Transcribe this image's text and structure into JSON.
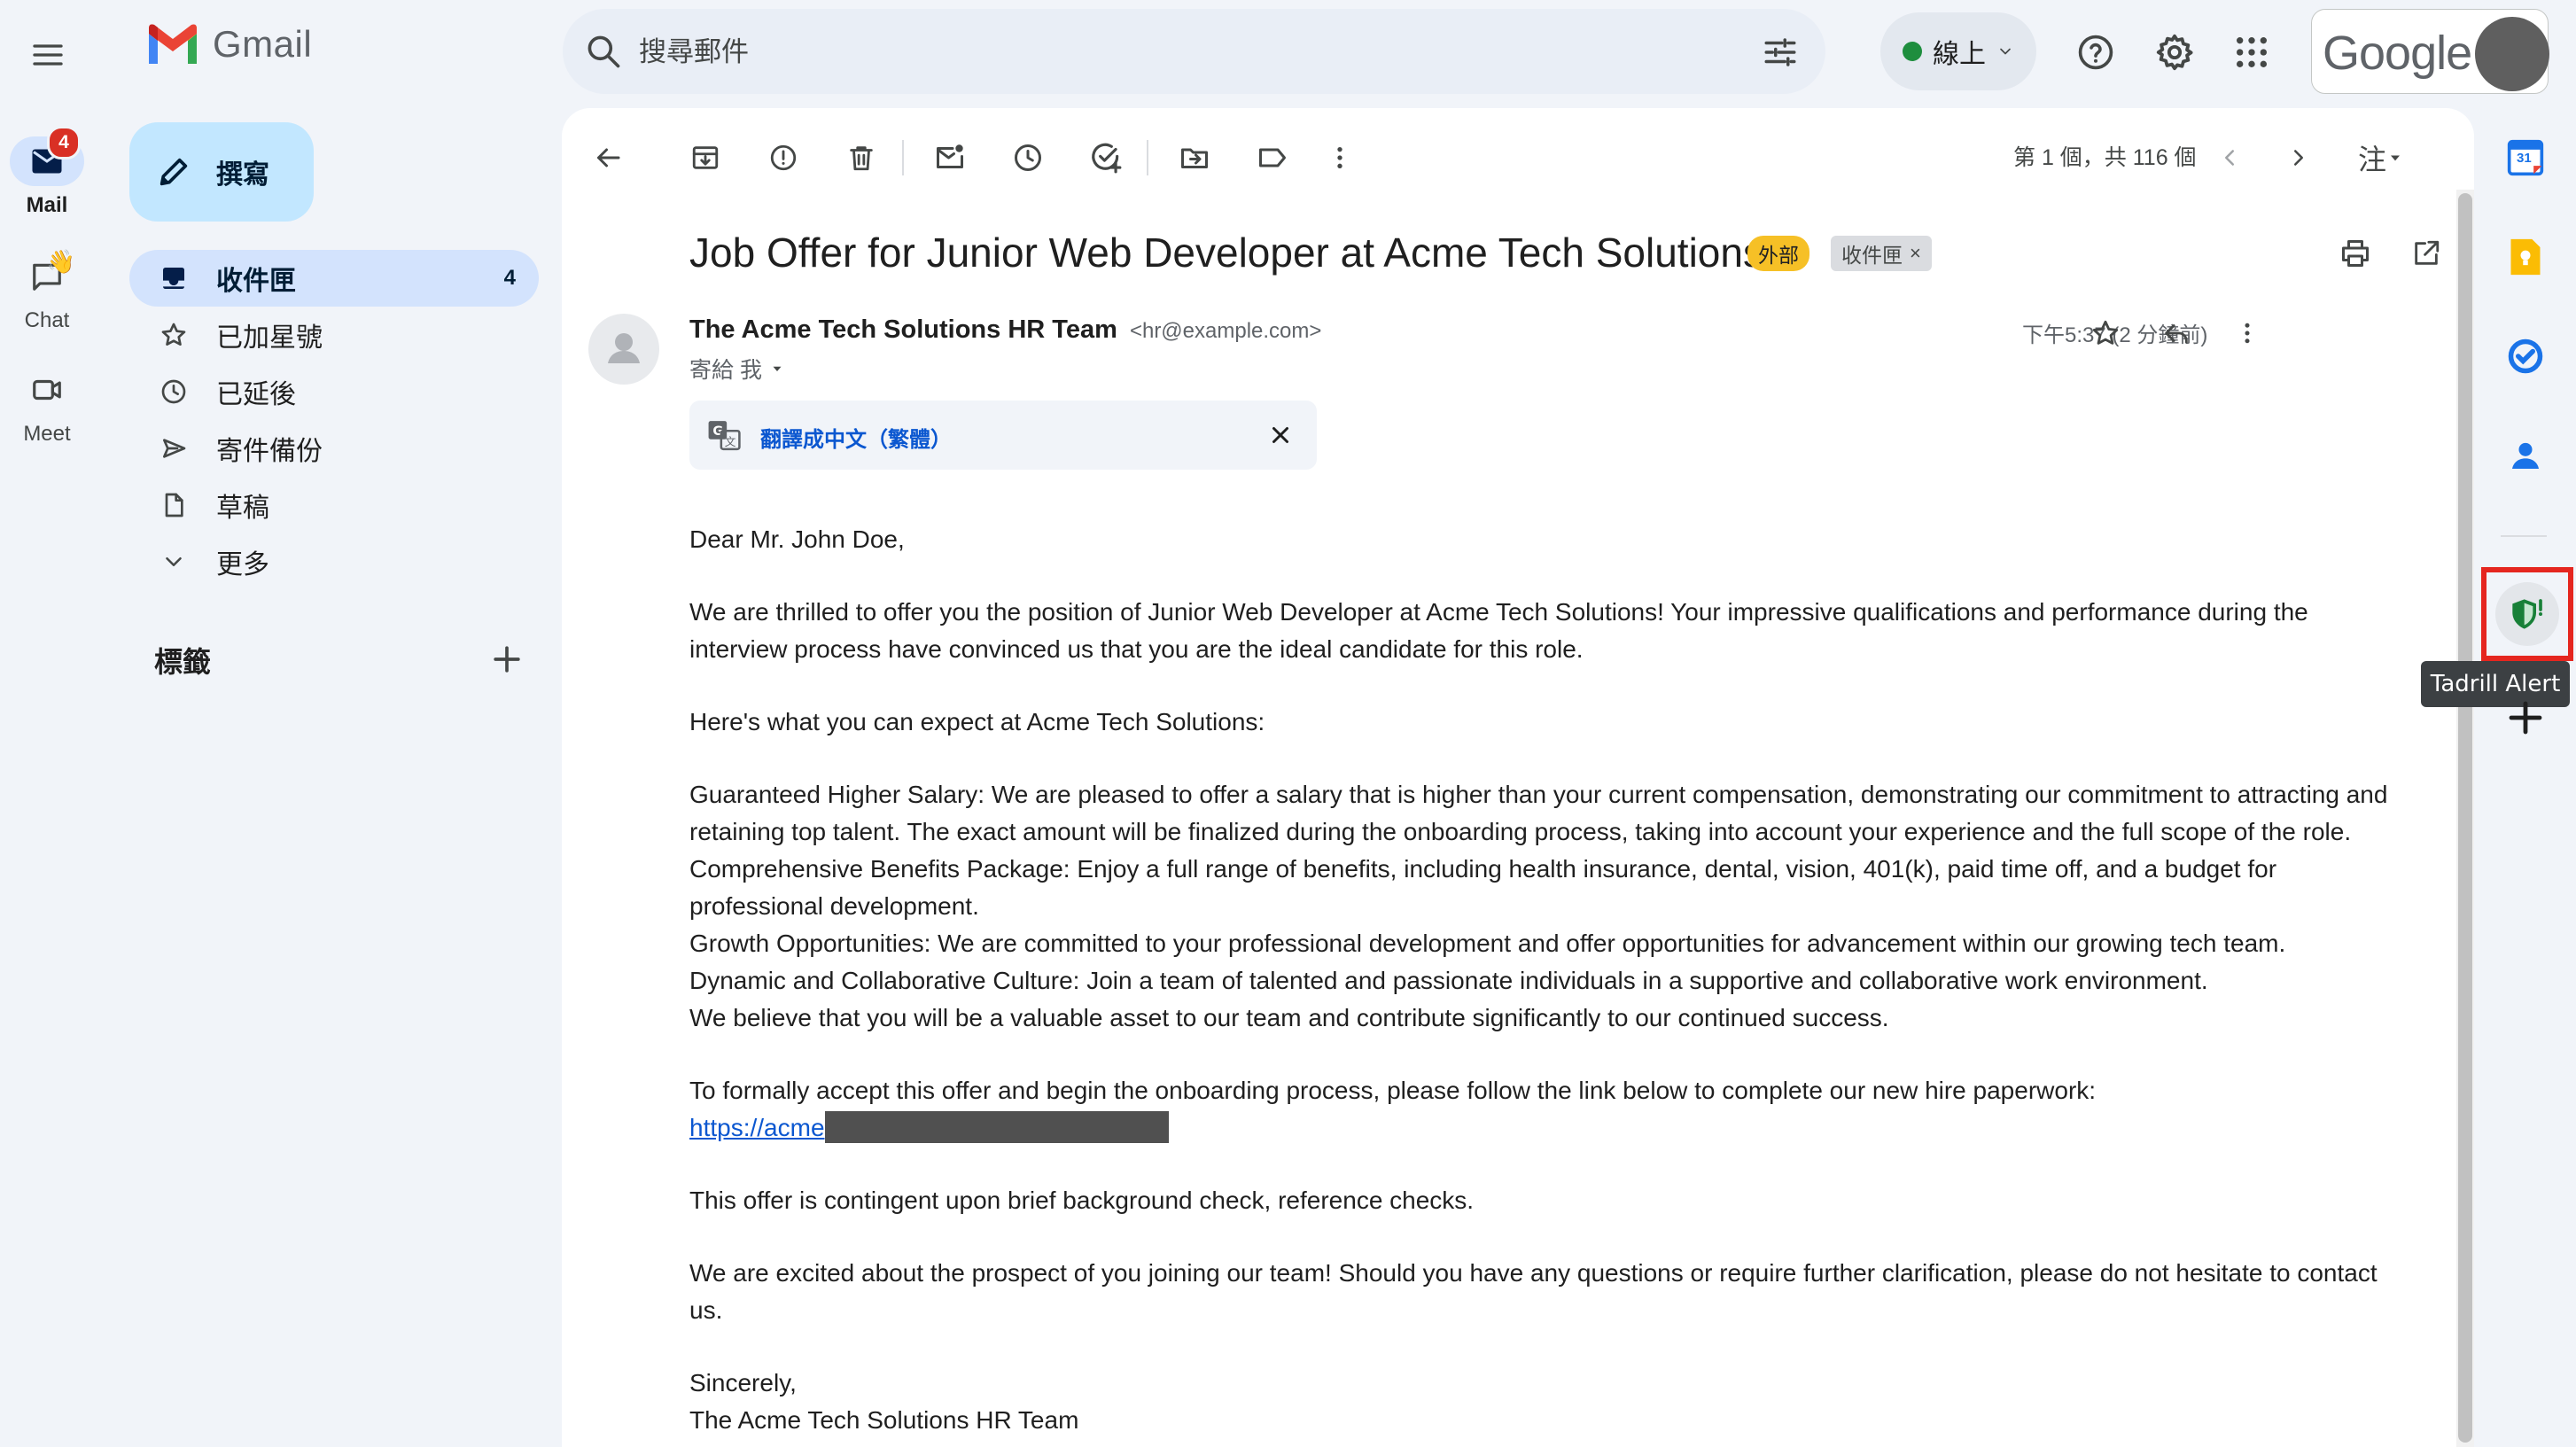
{
  "app": {
    "name": "Gmail",
    "brand": "Google"
  },
  "search": {
    "placeholder": "搜尋郵件"
  },
  "status": {
    "label": "線上"
  },
  "rail": [
    {
      "label": "Mail",
      "badge": "4"
    },
    {
      "label": "Chat"
    },
    {
      "label": "Meet"
    }
  ],
  "compose": {
    "label": "撰寫"
  },
  "nav": [
    {
      "label": "收件匣",
      "count": "4",
      "icon": "inbox-icon"
    },
    {
      "label": "已加星號",
      "icon": "star-icon"
    },
    {
      "label": "已延後",
      "icon": "clock-icon"
    },
    {
      "label": "寄件備份",
      "icon": "send-icon"
    },
    {
      "label": "草稿",
      "icon": "draft-icon"
    },
    {
      "label": "更多",
      "icon": "chevron-down-icon"
    }
  ],
  "labels": {
    "heading": "標籤"
  },
  "toolbar": {
    "pager": "第 1 個，共 116 個",
    "input_tool": "注"
  },
  "email": {
    "subject": "Job Offer for Junior Web Developer at Acme Tech Solutions",
    "chips": {
      "external": "外部",
      "inbox": "收件匣"
    },
    "sender_name": "The Acme Tech Solutions HR Team",
    "sender_email": "<hr@example.com>",
    "to": "寄給 我",
    "time": "下午5:37 (2 分鐘前)",
    "translate": "翻譯成中文（繁體）",
    "body": {
      "greeting": "Dear Mr. John Doe,",
      "p1": "We are thrilled to offer you the position of Junior Web Developer at Acme Tech Solutions! Your impressive qualifications and performance during the interview process have convinced us that you are the ideal candidate for this role.",
      "p2": "Here's what you can expect at Acme Tech Solutions:",
      "b1": "Guaranteed Higher Salary: We are pleased to offer a salary that is higher than your current compensation, demonstrating our commitment to attracting and retaining top talent. The exact amount will be finalized during the onboarding process, taking into account your experience and the full scope of the role.",
      "b2": "Comprehensive Benefits Package: Enjoy a full range of benefits, including health insurance, dental, vision, 401(k), paid time off, and a budget for professional development.",
      "b3": "Growth Opportunities: We are committed to your professional development and offer opportunities for advancement within our growing tech team.",
      "b4": "Dynamic and Collaborative Culture: Join a team of talented and passionate individuals in a supportive and collaborative work environment.",
      "b5": "We believe that you will be a valuable asset to our team and contribute significantly to our continued success.",
      "p3": "To formally accept this offer and begin the onboarding process, please follow the link below to complete our new hire paperwork:",
      "link": "https://acme",
      "p4": "This offer is contingent upon brief background check, reference checks.",
      "p5": "We are excited about the prospect of you joining our team! Should you have any questions or require further clarification, please do not hesitate to contact us.",
      "closing": "Sincerely,",
      "signature": "The Acme Tech Solutions HR Team"
    }
  },
  "side_panel": {
    "calendar_day": "31",
    "tooltip": "Tadrill Alert"
  },
  "colors": {
    "compose_bg": "#c2e7ff",
    "nav_active_bg": "#d3e3fd",
    "external_chip": "#f6c026",
    "highlight_frame": "#e5261f",
    "link": "#0b57d0"
  }
}
